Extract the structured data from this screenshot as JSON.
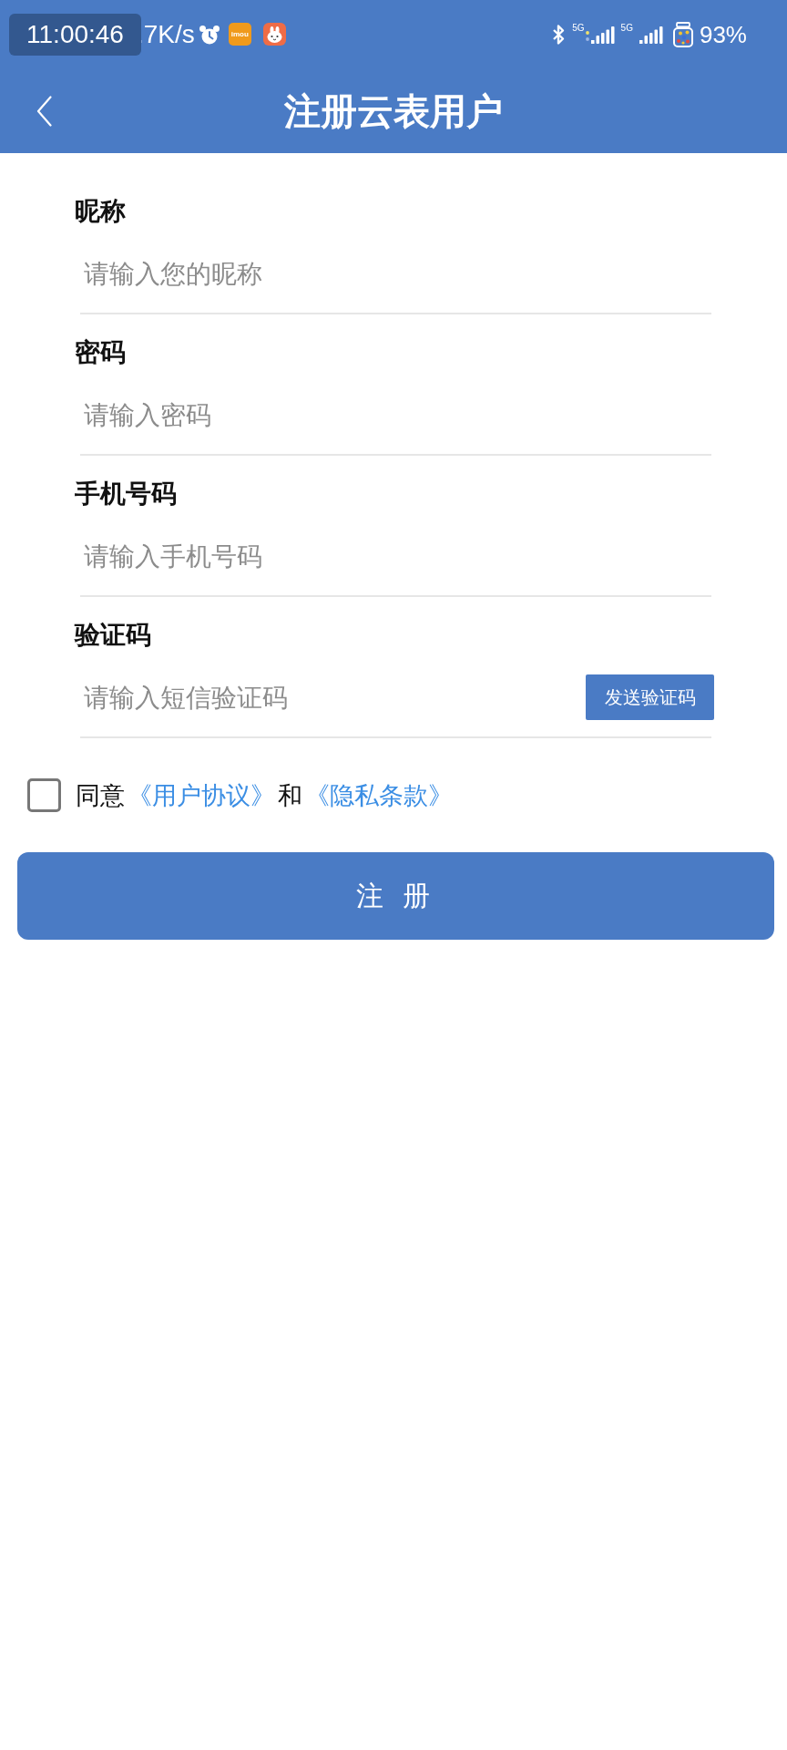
{
  "status_bar": {
    "time_overlay": "11:00:46",
    "network_speed": ".7K/s",
    "app_logo_text": "imou",
    "networks": [
      {
        "label": "5G",
        "data_activity": true
      },
      {
        "label": "5G",
        "data_activity": false
      }
    ],
    "battery": "93%"
  },
  "header": {
    "title": "注册云表用户"
  },
  "form": {
    "fields": [
      {
        "label": "昵称",
        "placeholder": "请输入您的昵称"
      },
      {
        "label": "密码",
        "placeholder": "请输入密码"
      },
      {
        "label": "手机号码",
        "placeholder": "请输入手机号码"
      },
      {
        "label": "验证码",
        "placeholder": "请输入短信验证码",
        "action_button": "发送验证码"
      }
    ]
  },
  "agreement": {
    "checked": false,
    "parts": [
      {
        "kind": "text",
        "text": "同意"
      },
      {
        "kind": "link",
        "text": "《用户协议》"
      },
      {
        "kind": "text",
        "text": "和"
      },
      {
        "kind": "link",
        "text": "《隐私条款》"
      }
    ]
  },
  "register_button": "注 册"
}
